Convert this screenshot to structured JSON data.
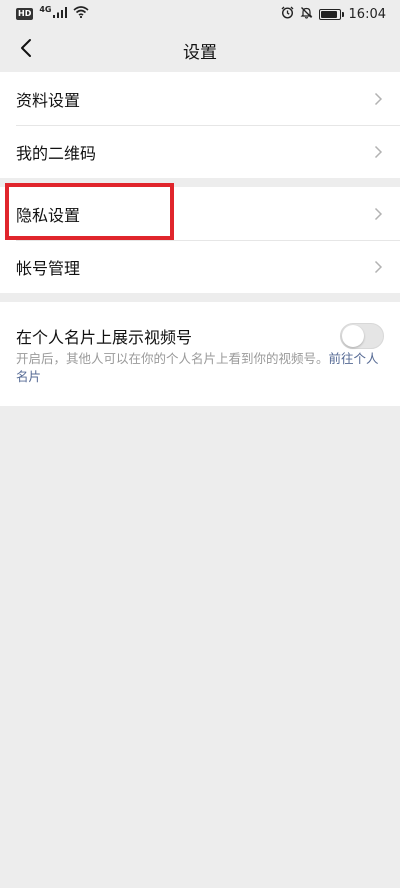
{
  "status_bar": {
    "hd_badge": "HD",
    "network_type": "4G",
    "time": "16:04",
    "icons": [
      "signal-icon",
      "wifi-icon",
      "alarm-icon",
      "mute-icon",
      "battery-icon"
    ],
    "battery_level": 0.9
  },
  "nav": {
    "back_icon": "back-chevron-icon",
    "title": "设置"
  },
  "group1": {
    "items": [
      {
        "label": "资料设置",
        "icon": "chevron-right-icon"
      },
      {
        "label": "我的二维码",
        "icon": "chevron-right-icon"
      }
    ]
  },
  "group2": {
    "items": [
      {
        "label": "隐私设置",
        "icon": "chevron-right-icon",
        "highlighted": true
      },
      {
        "label": "帐号管理",
        "icon": "chevron-right-icon"
      }
    ]
  },
  "video_channel": {
    "label": "在个人名片上展示视频号",
    "toggle_on": false,
    "description": "开启后，其他人可以在你的个人名片上看到你的视频号。",
    "link_text": "前往个人名片"
  },
  "colors": {
    "background": "#ededed",
    "card": "#ffffff",
    "highlight": "#e0252c",
    "link": "#576b95",
    "secondary_text": "#9a9a9a"
  }
}
